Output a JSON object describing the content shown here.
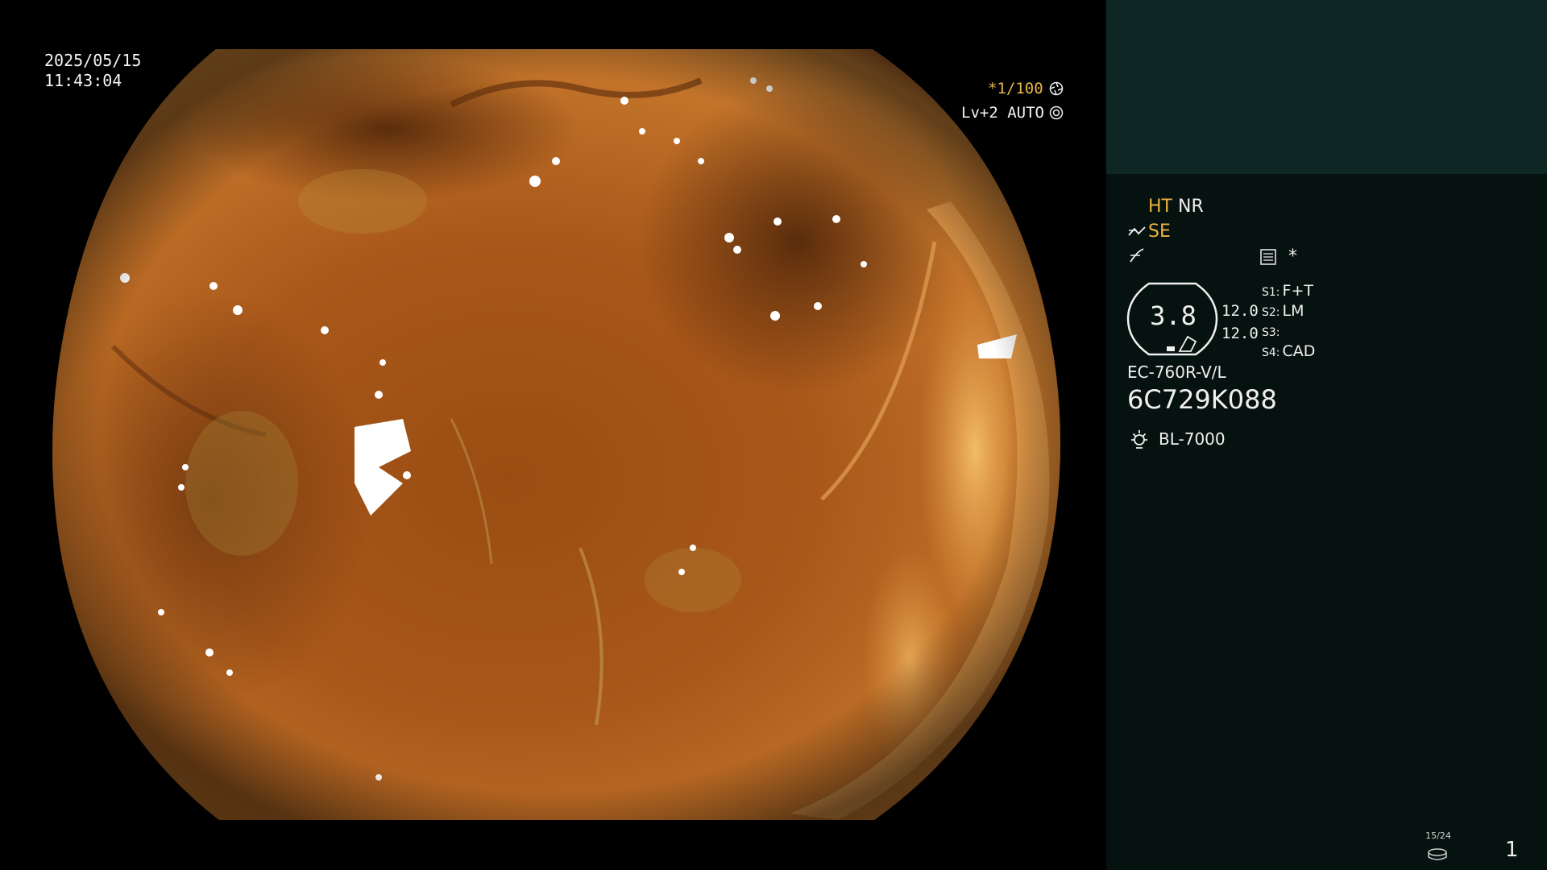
{
  "video_overlay": {
    "date": "2025/05/15",
    "time": "11:43:04",
    "shutter": "*1/100",
    "shutter_icon": "aperture-icon",
    "level": "Lv+2 AUTO",
    "auto_icon": "iris-auto-icon"
  },
  "info_panel": {
    "ht": "HT",
    "nr": "NR",
    "se": "SE",
    "se_icon": "structure-enhance-icon",
    "edge_icon": "edge-enhance-icon",
    "contrast_icon": "contrast-mode-icon",
    "asterisk": "*",
    "gauge_value": "3.8",
    "value_a": "12.0",
    "value_b": "12.0",
    "switches": [
      {
        "key": "S1:",
        "value": "F+T"
      },
      {
        "key": "S2:",
        "value": "LM"
      },
      {
        "key": "S3:",
        "value": ""
      },
      {
        "key": "S4:",
        "value": "CAD"
      }
    ],
    "scope_model": "EC-760R-V/L",
    "scope_serial": "6C729K088",
    "light_icon": "light-source-icon",
    "light_source": "BL-7000",
    "capture_count": "15/24",
    "capture_icon": "capture-storage-icon",
    "page_number": "1"
  },
  "colors": {
    "panel_bg": "#061210",
    "panel_header": "#0f2724",
    "amber": "#ecb341",
    "mucosa": "#b8641e"
  }
}
